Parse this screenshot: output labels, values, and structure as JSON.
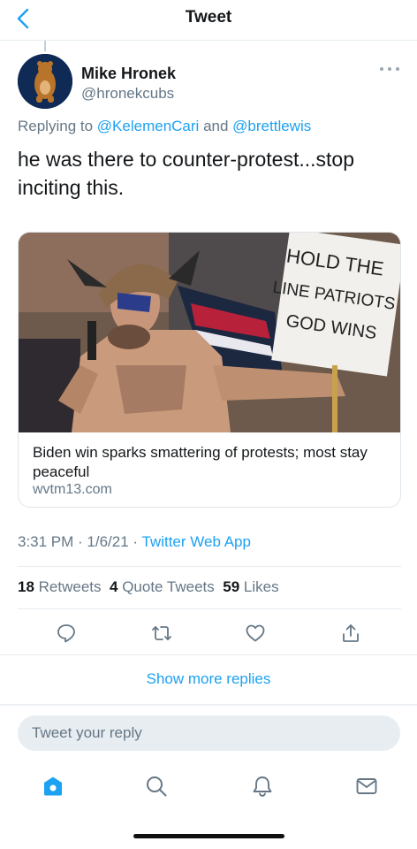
{
  "nav": {
    "title": "Tweet",
    "back_icon": "chevron-left-icon"
  },
  "tweet": {
    "author_name": "Mike Hronek",
    "author_handle": "@hronekcubs",
    "replying_prefix": "Replying to",
    "replying_to_1": "@KelemenCari",
    "replying_and": "and",
    "replying_to_2": "@brettlewis",
    "text": "he was there to counter-protest...stop inciting this.",
    "timestamp": "3:31 PM · 1/6/21 · ",
    "source_app": "Twitter Web App"
  },
  "card": {
    "headline": "Biden win sparks smattering of protests; most stay peaceful",
    "domain": "wvtm13.com",
    "sign_lines": [
      "HOLD THE",
      "LINE PATRIOTS",
      "GOD WINS"
    ]
  },
  "stats": {
    "retweets_count": "18",
    "retweets_label": "Retweets",
    "quotes_count": "4",
    "quotes_label": "Quote Tweets",
    "likes_count": "59",
    "likes_label": "Likes"
  },
  "actions": [
    "reply-icon",
    "retweet-icon",
    "like-icon",
    "share-icon"
  ],
  "show_more": "Show more replies",
  "reply_placeholder": "Tweet your reply",
  "tabbar": [
    "home-icon",
    "search-icon",
    "notifications-icon",
    "messages-icon"
  ],
  "colors": {
    "accent": "#1da1f2",
    "secondary_text": "#657786",
    "divider": "#e6ecf0"
  }
}
